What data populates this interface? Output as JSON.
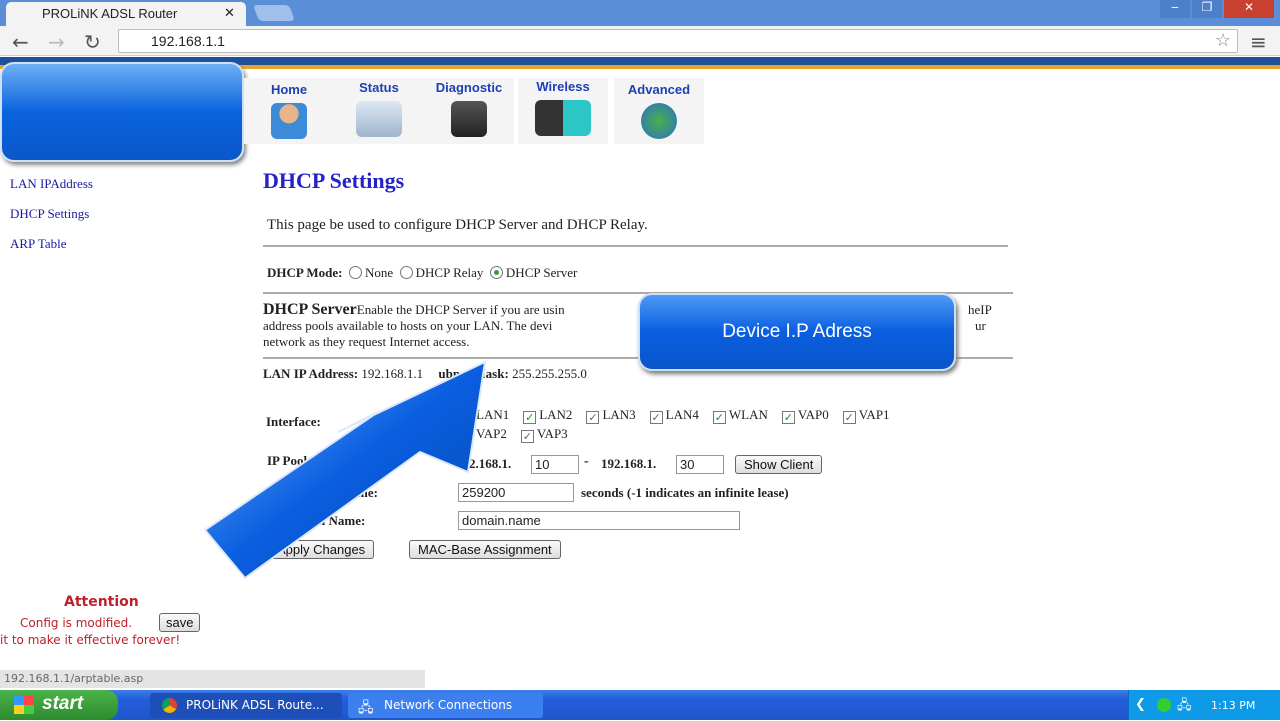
{
  "browser": {
    "tab_title": "PROLiNK ADSL Router",
    "url": "192.168.1.1",
    "status_url": "192.168.1.1/arptable.asp"
  },
  "topmenu": [
    {
      "label": "Home",
      "icon": "user-icon"
    },
    {
      "label": "Status",
      "icon": "monitor-icon"
    },
    {
      "label": "Diagnostic",
      "icon": "gear-icon"
    },
    {
      "label": "Wireless",
      "icon": "wireless-usb-icon"
    },
    {
      "label": "Advanced",
      "icon": "globe-computer-icon"
    }
  ],
  "sidebar": [
    "LAN IPAddress",
    "DHCP Settings",
    "ARP Table"
  ],
  "page": {
    "title": "DHCP Settings",
    "description": "This page be used to configure DHCP Server and DHCP Relay.",
    "mode_label": "DHCP Mode:",
    "modes": [
      "None",
      "DHCP Relay",
      "DHCP Server"
    ],
    "mode_selected": "DHCP Server",
    "server_heading": "DHCP Server",
    "server_text_1": "Enable the DHCP Server if you are usin",
    "server_text_1b": "heIP",
    "server_text_2": "address pools available to hosts on your LAN. The devi",
    "server_text_2b": "ur",
    "server_text_3": "network as they request Internet access.",
    "lan_ip_label": "LAN IP Address:",
    "lan_ip": "192.168.1.1",
    "mask_label": "ubnet Mask:",
    "mask": "255.255.255.0",
    "interface_label": "Interface:",
    "interfaces": [
      "LAN1",
      "LAN2",
      "LAN3",
      "LAN4",
      "WLAN",
      "VAP0",
      "VAP1",
      "VAP2",
      "VAP3"
    ],
    "pool_label": "IP Pool",
    "pool_prefix": "192.168.1.",
    "pool_start": "10",
    "pool_sep": "-",
    "pool_end": "30",
    "show_client": "Show Client",
    "lease_label": "Time:",
    "lease_value": "259200",
    "lease_note": "seconds (-1 indicates an infinite lease)",
    "domain_label": "n Name:",
    "domain_value": "domain.name",
    "apply": "Apply Changes",
    "mac_assign": "MAC-Base Assignment"
  },
  "callout": "Device I.P Adress",
  "attention": {
    "title": "Attention",
    "line1": "Config is modified.",
    "save": "save",
    "line2": "it to make it effective forever!"
  },
  "taskbar": {
    "start": "start",
    "tasks": [
      "PROLiNK ADSL Route...",
      "Network Connections"
    ],
    "clock": "1:13 PM"
  },
  "colors": {
    "accent": "#2323c8",
    "callout": "#0a5ee0",
    "attention": "#c0202a"
  }
}
